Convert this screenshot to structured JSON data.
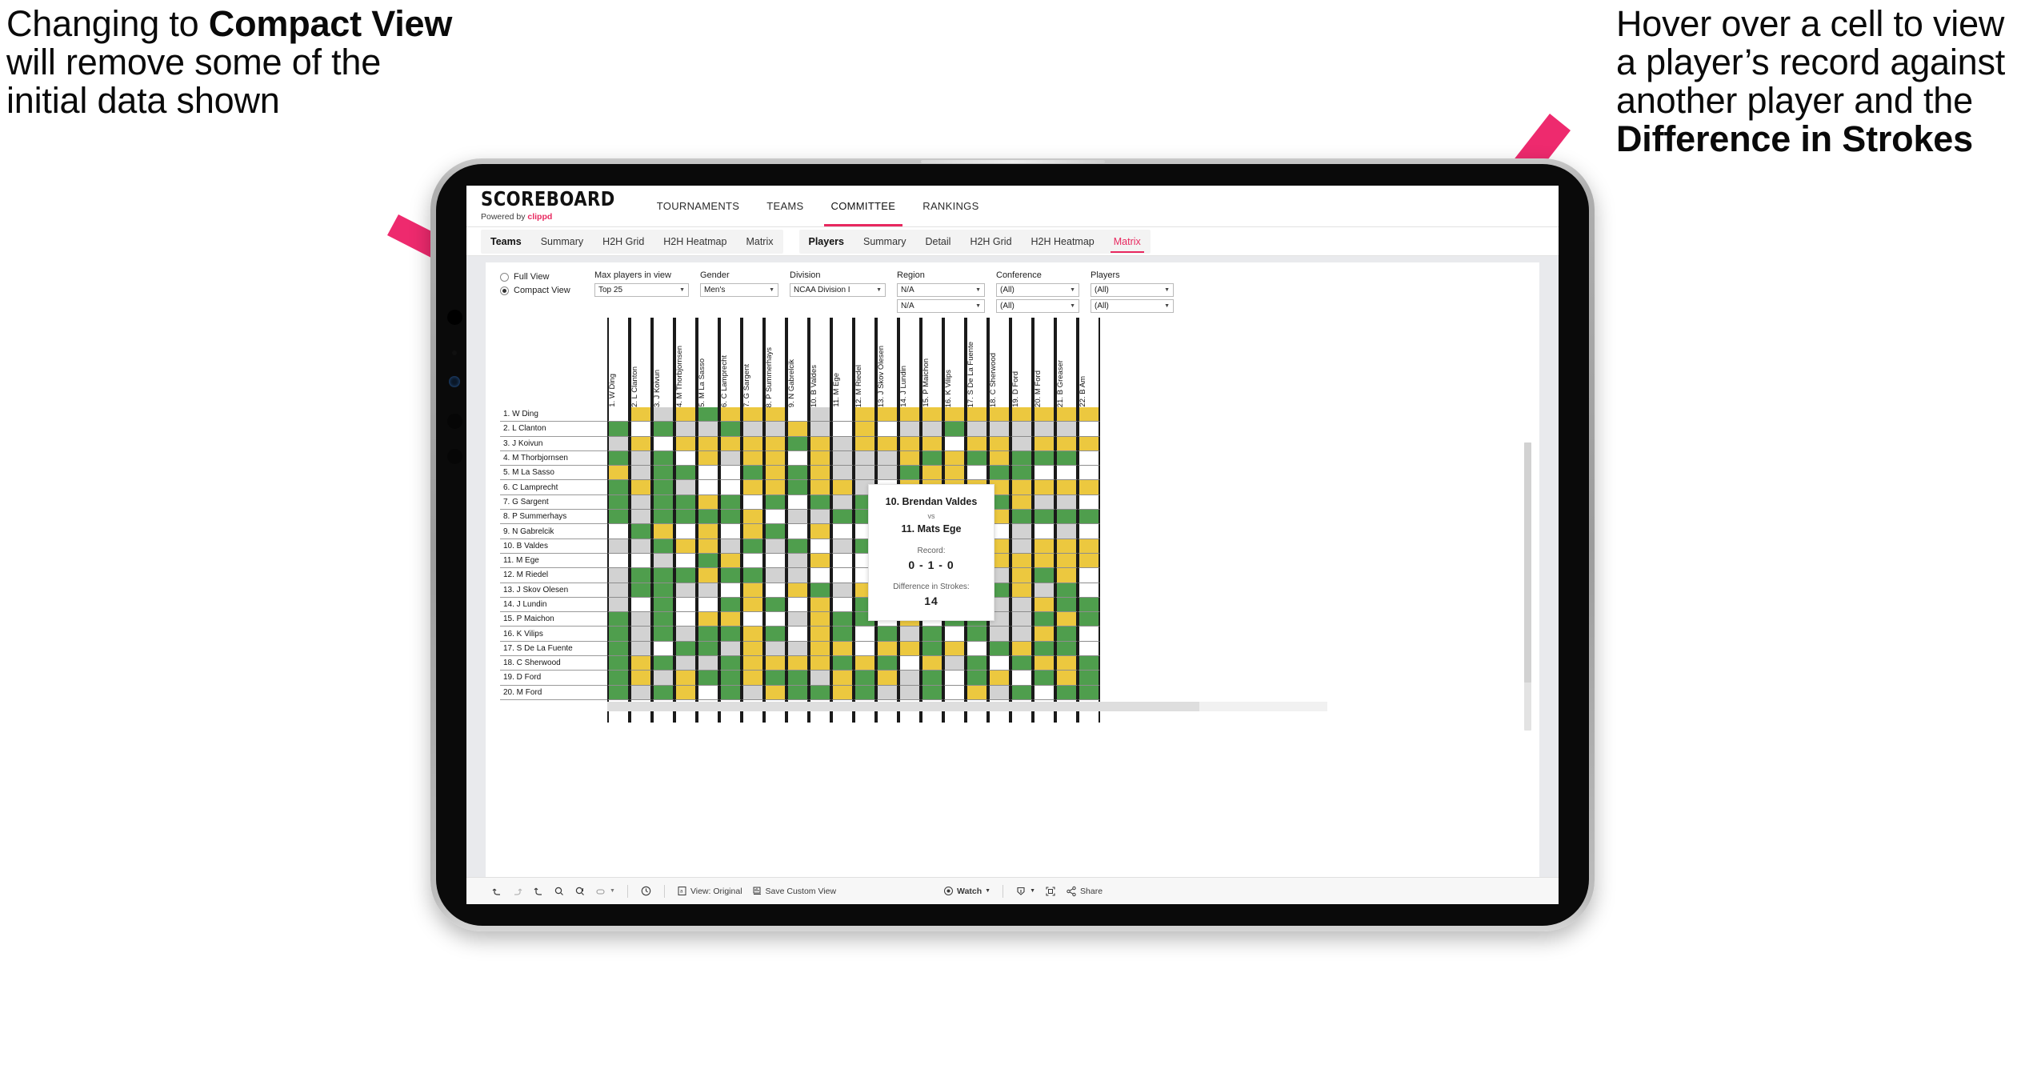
{
  "annotations": {
    "left": {
      "line1": "Changing to ",
      "bold": "Compact View",
      "line2": " will remove some of the initial data shown"
    },
    "right": {
      "line1": "Hover over a cell to view a player’s record against another player and the ",
      "bold": "Difference in Strokes"
    }
  },
  "brand": {
    "logo": "SCOREBOARD",
    "powered_prefix": "Powered by ",
    "powered_brand": "clippd",
    "accent": "#e8285f"
  },
  "topnav": {
    "items": [
      {
        "label": "TOURNAMENTS",
        "active": false
      },
      {
        "label": "TEAMS",
        "active": false
      },
      {
        "label": "COMMITTEE",
        "active": true
      },
      {
        "label": "RANKINGS",
        "active": false
      }
    ]
  },
  "subnav": {
    "groups": [
      {
        "lead": "Teams",
        "items": [
          "Summary",
          "H2H Grid",
          "H2H Heatmap",
          "Matrix"
        ],
        "active": null
      },
      {
        "lead": "Players",
        "items": [
          "Summary",
          "Detail",
          "H2H Grid",
          "H2H Heatmap",
          "Matrix"
        ],
        "active": "Matrix"
      }
    ]
  },
  "filters": {
    "view_mode": {
      "options": [
        "Full View",
        "Compact View"
      ],
      "selected": "Compact View"
    },
    "controls": [
      {
        "label": "Max players in view",
        "values": [
          "Top 25"
        ],
        "width": "w-top25"
      },
      {
        "label": "Gender",
        "values": [
          "Men's"
        ],
        "width": "w-gender"
      },
      {
        "label": "Division",
        "values": [
          "NCAA Division I"
        ],
        "width": "w-div"
      },
      {
        "label": "Region",
        "values": [
          "N/A",
          "N/A"
        ],
        "width": "w-region"
      },
      {
        "label": "Conference",
        "values": [
          "(All)",
          "(All)"
        ],
        "width": "w-conf"
      },
      {
        "label": "Players",
        "values": [
          "(All)",
          "(All)"
        ],
        "width": "w-players"
      }
    ]
  },
  "matrix": {
    "columns": [
      "1. W Ding",
      "2. L Clanton",
      "3. J Koivun",
      "4. M Thorbjornsen",
      "5. M La Sasso",
      "6. C Lamprecht",
      "7. G Sargent",
      "8. P Summerhays",
      "9. N Gabrelcik",
      "10. B Valdes",
      "11. M Ege",
      "12. M Riedel",
      "13. J Skov Olesen",
      "14. J Lundin",
      "15. P Maichon",
      "16. K Vilips",
      "17. S De La Fuente",
      "18. C Sherwood",
      "19. D Ford",
      "20. M Ford",
      "21. B Greaser",
      "22. B Am"
    ],
    "rows": [
      "1. W Ding",
      "2. L Clanton",
      "3. J Koivun",
      "4. M Thorbjornsen",
      "5. M La Sasso",
      "6. C Lamprecht",
      "7. G Sargent",
      "8. P Summerhays",
      "9. N Gabrelcik",
      "10. B Valdes",
      "11. M Ege",
      "12. M Riedel",
      "13. J Skov Olesen",
      "14. J Lundin",
      "15. P Maichon",
      "16. K Vilips",
      "17. S De La Fuente",
      "18. C Sherwood",
      "19. D Ford",
      "20. M Ford"
    ],
    "legend_colors": {
      "win": "#4f9e4d",
      "loss": "#ecc83f",
      "tie": "#d2d2d2",
      "none": "#ffffff"
    },
    "cells": [
      [
        "w",
        "y",
        "a",
        "y",
        "g",
        "y",
        "y",
        "y",
        "w",
        "a",
        "w",
        "y",
        "y",
        "y",
        "y",
        "y",
        "y",
        "y",
        "y",
        "y",
        "y",
        "y"
      ],
      [
        "g",
        "w",
        "g",
        "a",
        "a",
        "g",
        "a",
        "a",
        "y",
        "a",
        "w",
        "y",
        "w",
        "a",
        "a",
        "g",
        "a",
        "a",
        "a",
        "a",
        "a",
        "w"
      ],
      [
        "a",
        "y",
        "w",
        "y",
        "y",
        "y",
        "y",
        "y",
        "g",
        "y",
        "a",
        "y",
        "y",
        "y",
        "y",
        "w",
        "y",
        "y",
        "a",
        "y",
        "y",
        "y"
      ],
      [
        "g",
        "a",
        "g",
        "w",
        "y",
        "a",
        "y",
        "y",
        "w",
        "y",
        "a",
        "a",
        "a",
        "y",
        "g",
        "y",
        "g",
        "y",
        "g",
        "g",
        "g",
        "w"
      ],
      [
        "y",
        "a",
        "g",
        "g",
        "w",
        "w",
        "g",
        "y",
        "g",
        "y",
        "a",
        "a",
        "a",
        "g",
        "y",
        "y",
        "w",
        "g",
        "g",
        "w",
        "w",
        "w"
      ],
      [
        "g",
        "y",
        "g",
        "a",
        "w",
        "w",
        "y",
        "y",
        "g",
        "y",
        "y",
        "a",
        "w",
        "y",
        "y",
        "y",
        "y",
        "y",
        "y",
        "y",
        "y",
        "y"
      ],
      [
        "g",
        "a",
        "g",
        "g",
        "y",
        "g",
        "w",
        "g",
        "w",
        "g",
        "a",
        "g",
        "a",
        "g",
        "g",
        "a",
        "g",
        "g",
        "y",
        "a",
        "a",
        "w"
      ],
      [
        "g",
        "a",
        "g",
        "g",
        "g",
        "g",
        "y",
        "w",
        "a",
        "a",
        "g",
        "g",
        "g",
        "g",
        "g",
        "a",
        "g",
        "y",
        "g",
        "g",
        "g",
        "g"
      ],
      [
        "w",
        "g",
        "y",
        "w",
        "y",
        "w",
        "y",
        "g",
        "w",
        "y",
        "w",
        "w",
        "y",
        "w",
        "w",
        "y",
        "w",
        "w",
        "a",
        "w",
        "a",
        "w"
      ],
      [
        "a",
        "a",
        "g",
        "y",
        "y",
        "a",
        "g",
        "a",
        "g",
        "w",
        "a",
        "g",
        "y",
        "a",
        "y",
        "g",
        "g",
        "y",
        "a",
        "y",
        "y",
        "y"
      ],
      [
        "w",
        "w",
        "a",
        "w",
        "g",
        "y",
        "w",
        "w",
        "a",
        "y",
        "w",
        "w",
        "g",
        "w",
        "y",
        "y",
        "y",
        "y",
        "y",
        "y",
        "y",
        "y"
      ],
      [
        "a",
        "g",
        "g",
        "g",
        "y",
        "g",
        "g",
        "a",
        "a",
        "w",
        "w",
        "w",
        "y",
        "g",
        "g",
        "a",
        "g",
        "a",
        "y",
        "g",
        "y",
        "w"
      ],
      [
        "a",
        "g",
        "g",
        "a",
        "a",
        "w",
        "y",
        "w",
        "y",
        "g",
        "a",
        "y",
        "w",
        "g",
        "a",
        "y",
        "a",
        "g",
        "y",
        "a",
        "g",
        "w"
      ],
      [
        "a",
        "w",
        "g",
        "w",
        "w",
        "g",
        "y",
        "g",
        "w",
        "y",
        "w",
        "g",
        "a",
        "w",
        "g",
        "g",
        "g",
        "a",
        "a",
        "y",
        "g",
        "g"
      ],
      [
        "g",
        "a",
        "g",
        "w",
        "y",
        "y",
        "w",
        "w",
        "a",
        "y",
        "g",
        "g",
        "w",
        "y",
        "w",
        "g",
        "g",
        "a",
        "a",
        "g",
        "y",
        "g"
      ],
      [
        "g",
        "a",
        "g",
        "a",
        "g",
        "g",
        "y",
        "g",
        "w",
        "y",
        "g",
        "w",
        "g",
        "a",
        "g",
        "w",
        "g",
        "a",
        "a",
        "y",
        "g",
        "w"
      ],
      [
        "g",
        "a",
        "w",
        "g",
        "g",
        "a",
        "y",
        "a",
        "a",
        "y",
        "y",
        "w",
        "y",
        "y",
        "g",
        "y",
        "w",
        "g",
        "y",
        "g",
        "g",
        "w"
      ],
      [
        "g",
        "y",
        "g",
        "a",
        "a",
        "g",
        "y",
        "y",
        "y",
        "y",
        "g",
        "y",
        "g",
        "w",
        "y",
        "a",
        "g",
        "w",
        "g",
        "y",
        "y",
        "g"
      ],
      [
        "g",
        "y",
        "a",
        "y",
        "g",
        "g",
        "y",
        "g",
        "g",
        "a",
        "y",
        "g",
        "y",
        "a",
        "g",
        "w",
        "g",
        "y",
        "w",
        "g",
        "y",
        "g"
      ],
      [
        "g",
        "a",
        "g",
        "y",
        "w",
        "g",
        "a",
        "y",
        "g",
        "g",
        "y",
        "g",
        "a",
        "a",
        "g",
        "w",
        "y",
        "a",
        "g",
        "w",
        "g",
        "g"
      ]
    ]
  },
  "tooltip": {
    "player_a": "10. Brendan Valdes",
    "vs": "vs",
    "player_b": "11. Mats Ege",
    "record_label": "Record:",
    "record_value": "0 - 1 - 0",
    "strokes_label": "Difference in Strokes:",
    "strokes_value": "14"
  },
  "toolbar": {
    "undo": "undo-icon",
    "redo": "redo-icon",
    "revert": "revert-icon",
    "refresh": "refresh-icon",
    "pause": "pause-icon",
    "highlight": "highlight-icon",
    "clock": "clock-icon",
    "view_label": "View: Original",
    "save_label": "Save Custom View",
    "watch_label": "Watch",
    "download_label": "download-icon",
    "fullscreen_label": "fullscreen-icon",
    "share_label": "Share"
  }
}
